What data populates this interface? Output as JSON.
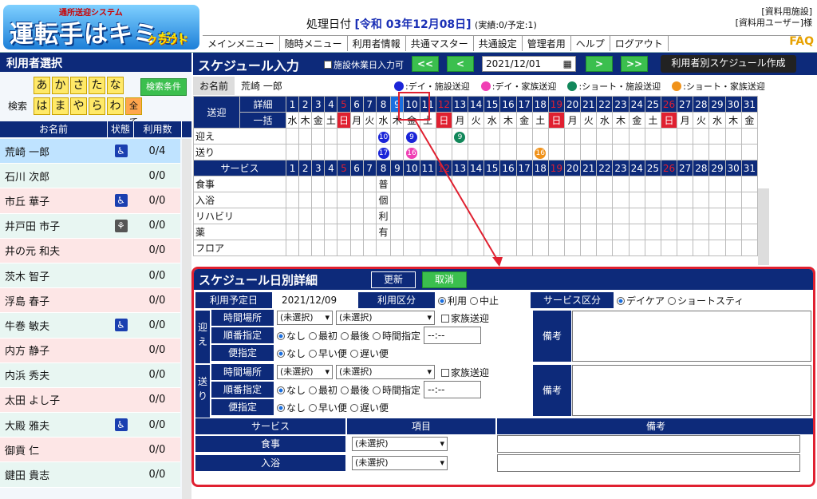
{
  "app": {
    "logo_sub": "通所送迎システム",
    "logo_main": "運転手はキミ",
    "logo_mid": "だ!!",
    "logo_cloud": "クラウド"
  },
  "header": {
    "date_label": "処理日付",
    "date_value": "[令和 03年12月08日]",
    "date_note": "(実績:0/予定:1)",
    "facility": "[資料用施設]",
    "user": "[資料用ユーザー]様",
    "faq": "FAQ"
  },
  "menu": [
    "メインメニュー",
    "随時メニュー",
    "利用者情報",
    "共通マスター",
    "共通設定",
    "管理者用",
    "ヘルプ",
    "ログアウト"
  ],
  "left": {
    "title": "利用者選択",
    "search_label": "検索",
    "kana_row1": [
      "あ",
      "か",
      "さ",
      "た",
      "な"
    ],
    "kana_row2": [
      "は",
      "ま",
      "や",
      "ら",
      "わ",
      "全て"
    ],
    "search_button": "検索条件",
    "cols": [
      "お名前",
      "状態",
      "利用数"
    ],
    "users": [
      {
        "name": "荒崎 一郎",
        "status": "wheelchair",
        "count": "0/4",
        "sel": true
      },
      {
        "name": "石川 次郎",
        "status": "",
        "count": "0/0"
      },
      {
        "name": "市丘 華子",
        "status": "wheelchair",
        "count": "0/0"
      },
      {
        "name": "井戸田 市子",
        "status": "walker",
        "count": "0/0"
      },
      {
        "name": "井の元 和夫",
        "status": "",
        "count": "0/0"
      },
      {
        "name": "茨木 智子",
        "status": "",
        "count": "0/0"
      },
      {
        "name": "浮島 春子",
        "status": "",
        "count": "0/0"
      },
      {
        "name": "牛巻 敏夫",
        "status": "wheelchair",
        "count": "0/0"
      },
      {
        "name": "内方 静子",
        "status": "",
        "count": "0/0"
      },
      {
        "name": "内浜 秀夫",
        "status": "",
        "count": "0/0"
      },
      {
        "name": "太田 よし子",
        "status": "",
        "count": "0/0"
      },
      {
        "name": "大殿 雅夫",
        "status": "wheelchair",
        "count": "0/0"
      },
      {
        "name": "御貢 仁",
        "status": "",
        "count": "0/0"
      },
      {
        "name": "鍵田 貴志",
        "status": "",
        "count": "0/0"
      }
    ]
  },
  "schedule": {
    "title": "スケジュール入力",
    "holiday_check": "施設休業日入力可",
    "prev2": "<<",
    "prev": "<",
    "date": "2021/12/01",
    "next": ">",
    "next2": ">>",
    "make_button": "利用者別スケジュール作成",
    "name_label": "お名前",
    "name_value": "荒崎 一郎",
    "legend": [
      {
        "label": ":デイ・施設送迎",
        "color": "#1a24d8"
      },
      {
        "label": ":デイ・家族送迎",
        "color": "#f03fb4"
      },
      {
        "label": ":ショート・施設送迎",
        "color": "#11875a"
      },
      {
        "label": ":ショート・家族送迎",
        "color": "#f0921a"
      }
    ],
    "row_sougei": "送迎",
    "row_detail": "詳細",
    "row_bulk": "一括",
    "row_mukae": "迎え",
    "row_okuri": "送り",
    "row_service": "サービス",
    "days": [
      "1",
      "2",
      "3",
      "4",
      "5",
      "6",
      "7",
      "8",
      "9",
      "10",
      "11",
      "12",
      "13",
      "14",
      "15",
      "16",
      "17",
      "18",
      "19",
      "20",
      "21",
      "22",
      "23",
      "24",
      "25",
      "26",
      "27",
      "28",
      "29",
      "30",
      "31"
    ],
    "weekdays": [
      "水",
      "木",
      "金",
      "土",
      "日",
      "月",
      "火",
      "水",
      "木",
      "金",
      "土",
      "日",
      "月",
      "火",
      "水",
      "木",
      "金",
      "土",
      "日",
      "月",
      "火",
      "水",
      "木",
      "金",
      "土",
      "日",
      "月",
      "火",
      "水",
      "木",
      "金"
    ],
    "services": [
      "食事",
      "入浴",
      "リハビリ",
      "薬",
      "フロア"
    ],
    "service_vals": [
      "普",
      "個",
      "利",
      "有",
      ""
    ]
  },
  "detail": {
    "title": "スケジュール日別詳細",
    "update": "更新",
    "cancel": "取消",
    "plan_date_label": "利用予定日",
    "plan_date": "2021/12/09",
    "kubun_label": "利用区分",
    "use": "利用",
    "stop": "中止",
    "svc_kubun_label": "サービス区分",
    "day_care": "デイケア",
    "short_stay": "ショートスティ",
    "mukae": "迎え",
    "okuri": "送り",
    "time_place": "時間場所",
    "order": "順番指定",
    "bin": "便指定",
    "unsel": "(未選択)",
    "family": "家族送迎",
    "none": "なし",
    "first": "最初",
    "last": "最後",
    "time_spec": "時間指定",
    "time_ph": "--:--",
    "early": "早い便",
    "late": "遅い便",
    "note": "備考",
    "svc_head": "サービス",
    "item_head": "項目",
    "note_head": "備考",
    "svc_rows": [
      "食事",
      "入浴"
    ]
  }
}
